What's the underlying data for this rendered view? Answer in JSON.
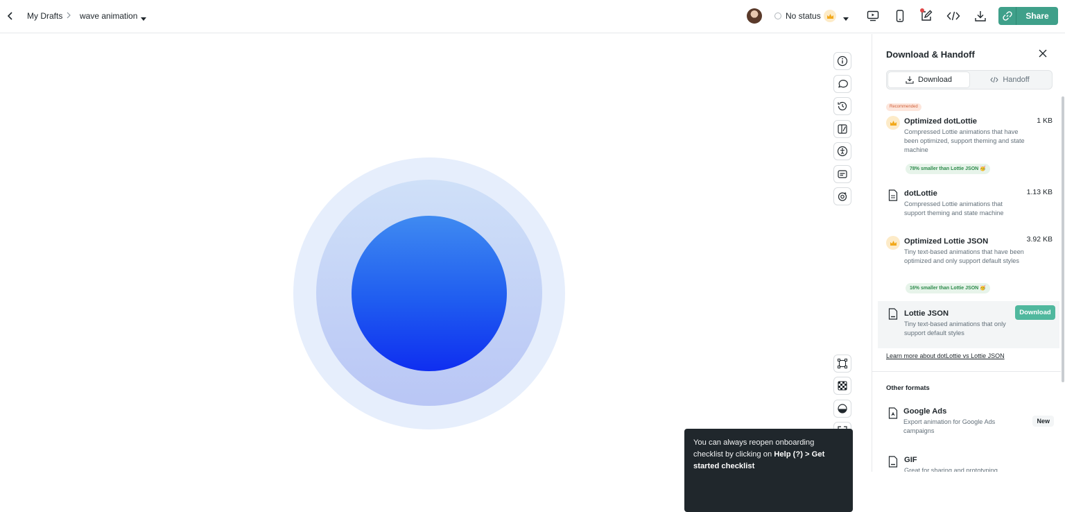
{
  "breadcrumb": {
    "parent": "My Drafts",
    "current": "wave animation"
  },
  "status": {
    "label": "No status"
  },
  "share": {
    "label": "Share"
  },
  "colors": {
    "accent": "#3fa08a",
    "download_button": "#50b89e",
    "core_top": "#3f8af1",
    "core_bottom": "#0f2ef0"
  },
  "panel": {
    "title": "Download & Handoff",
    "tabs": [
      {
        "label": "Download",
        "active": true,
        "icon": "download-icon"
      },
      {
        "label": "Handoff",
        "active": false,
        "icon": "code-icon"
      }
    ],
    "recommended_label": "Recommended",
    "formats": [
      {
        "name": "Optimized dotLottie",
        "desc": "Compressed Lottie animations that have been optimized, support theming and state machine",
        "size": "1 KB",
        "badge": "78% smaller than Lottie JSON 🥳",
        "icon": "crown-icon"
      },
      {
        "name": "dotLottie",
        "desc": "Compressed Lottie animations that support theming and state machine",
        "size": "1.13 KB",
        "icon": "file-icon"
      },
      {
        "name": "Optimized Lottie JSON",
        "desc": "Tiny text-based animations that have been optimized and only support default styles",
        "size": "3.92 KB",
        "badge": "16% smaller than Lottie JSON 🥳",
        "icon": "crown-icon"
      },
      {
        "name": "Lottie JSON",
        "desc": "Tiny text-based animations that only support default styles",
        "action": "Download",
        "icon": "json-file-icon"
      }
    ],
    "learn_more": "Learn more about dotLottie vs Lottie JSON",
    "other_title": "Other formats",
    "other_formats": [
      {
        "name": "Google Ads",
        "desc": "Export animation for Google Ads campaigns",
        "badge": "New",
        "icon": "file-icon"
      },
      {
        "name": "GIF",
        "desc": "Great for sharing and prototyping",
        "icon": "gif-file-icon"
      }
    ]
  },
  "toast": {
    "text_pre": "You can always reopen onboarding checklist by clicking on ",
    "text_bold": "Help (?) > Get started checklist"
  }
}
